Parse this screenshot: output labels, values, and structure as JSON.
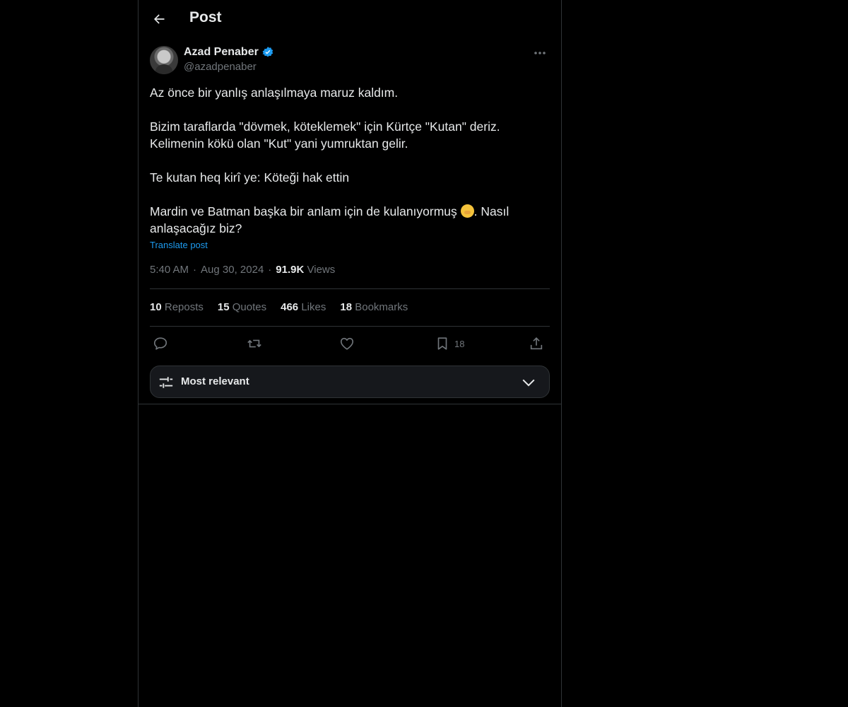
{
  "header": {
    "title": "Post"
  },
  "author": {
    "name": "Azad Penaber",
    "handle": "@azadpenaber",
    "verified": true
  },
  "post": {
    "paragraphs": [
      "Az önce bir yanlış anlaşılmaya maruz kaldım.",
      "Bizim taraflarda \"dövmek, köteklemek\" için Kürtçe \"Kutan\" deriz.",
      "Kelimenin kökü olan \"Kut\" yani yumruktan gelir.",
      "Te kutan heq kirî ye: Köteği hak ettin",
      "Mardin ve Batman başka bir anlam için de kulanıyormuş",
      ". Nasıl anlaşacağız biz?"
    ],
    "translate_label": "Translate post",
    "time": "5:40 AM",
    "date": "Aug 30, 2024",
    "views_count": "91.9K",
    "views_label": "Views"
  },
  "stats": {
    "reposts_count": "10",
    "reposts_label": "Reposts",
    "quotes_count": "15",
    "quotes_label": "Quotes",
    "likes_count": "466",
    "likes_label": "Likes",
    "bookmarks_count": "18",
    "bookmarks_label": "Bookmarks"
  },
  "actions": {
    "bookmark_count": "18"
  },
  "sort": {
    "label": "Most relevant"
  },
  "icons": {
    "back": "arrow-left-icon",
    "verified": "verified-badge-icon",
    "more": "more-horizontal-icon",
    "reply": "reply-icon",
    "repost": "repost-icon",
    "like": "heart-icon",
    "bookmark": "bookmark-icon",
    "share": "share-icon",
    "sort": "sliders-icon",
    "chevron": "chevron-down-icon",
    "emoji": "shushing-face-emoji"
  },
  "colors": {
    "background": "#000000",
    "text": "#e7e9ea",
    "muted": "#71767b",
    "accent": "#1d9bf0",
    "border": "#2f3336"
  }
}
